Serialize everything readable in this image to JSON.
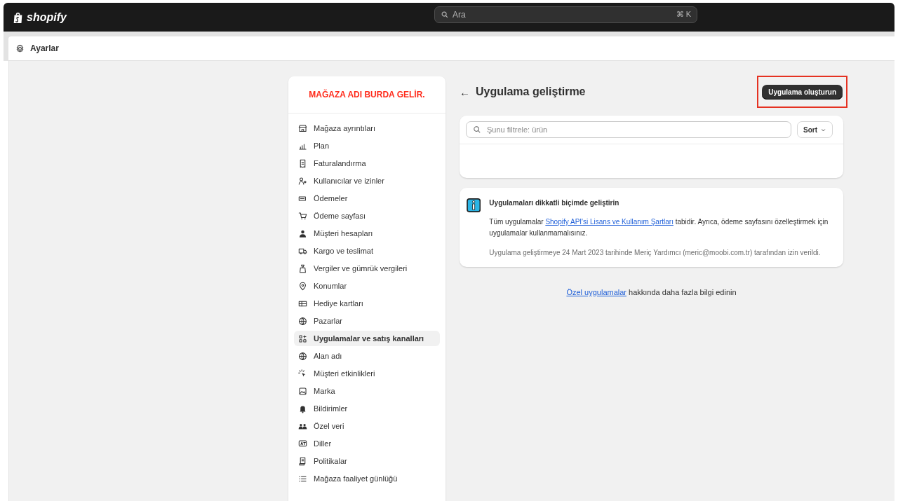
{
  "topbar": {
    "logo": "shopify",
    "search": {
      "placeholder": "Ara",
      "shortcut": "⌘ K"
    }
  },
  "header": {
    "title": "Ayarlar"
  },
  "sidebar": {
    "store_name": "MAĞAZA ADI BURDA GELİR.",
    "items": [
      {
        "label": "Mağaza ayrıntıları",
        "selected": false
      },
      {
        "label": "Plan",
        "selected": false
      },
      {
        "label": "Faturalandırma",
        "selected": false
      },
      {
        "label": "Kullanıcılar ve izinler",
        "selected": false
      },
      {
        "label": "Ödemeler",
        "selected": false
      },
      {
        "label": "Ödeme sayfası",
        "selected": false
      },
      {
        "label": "Müşteri hesapları",
        "selected": false
      },
      {
        "label": "Kargo ve teslimat",
        "selected": false
      },
      {
        "label": "Vergiler ve gümrük vergileri",
        "selected": false
      },
      {
        "label": "Konumlar",
        "selected": false
      },
      {
        "label": "Hediye kartları",
        "selected": false
      },
      {
        "label": "Pazarlar",
        "selected": false
      },
      {
        "label": "Uygulamalar ve satış kanalları",
        "selected": true
      },
      {
        "label": "Alan adı",
        "selected": false
      },
      {
        "label": "Müşteri etkinlikleri",
        "selected": false
      },
      {
        "label": "Marka",
        "selected": false
      },
      {
        "label": "Bildirimler",
        "selected": false
      },
      {
        "label": "Özel veri",
        "selected": false
      },
      {
        "label": "Diller",
        "selected": false
      },
      {
        "label": "Politikalar",
        "selected": false
      },
      {
        "label": "Mağaza faaliyet günlüğü",
        "selected": false
      }
    ]
  },
  "page": {
    "back": "←",
    "title": "Uygulama geliştirme",
    "create_button": {
      "label": "Uygulama oluşturun",
      "highlighted": true
    },
    "filter": {
      "placeholder": "Şunu filtrele: ürün"
    },
    "sort": {
      "label": "Sort"
    },
    "notice": {
      "title": "Uygulamaları dikkatli biçimde geliştirin",
      "body": [
        {
          "kind": "text",
          "text": "Tüm uygulamalar "
        },
        {
          "kind": "link",
          "text": "Shopify API'si Lisans ve Kullanım Şartları"
        },
        {
          "kind": "text",
          "text": " tabidir. Ayrıca, ödeme sayfasını özelleştirmek için uygulamalar kullanmamalısınız."
        }
      ],
      "permission": "Uygulama geliştirmeye 24 Mart 2023 tarihinde Meriç Yardımcı (meric@moobi.com.tr) tarafından izin verildi."
    },
    "footer": [
      {
        "kind": "link",
        "text": "Özel uygulamalar"
      },
      {
        "kind": "text",
        "text": " hakkında daha fazla bilgi edinin"
      }
    ]
  }
}
